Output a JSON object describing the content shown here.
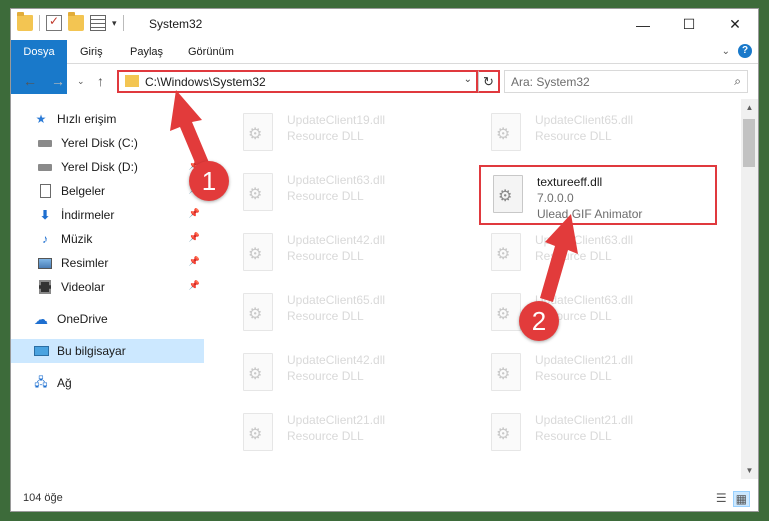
{
  "window": {
    "title": "System32"
  },
  "ribbon": {
    "tabs": [
      "Dosya",
      "Giriş",
      "Paylaş",
      "Görünüm"
    ]
  },
  "address": {
    "path": "C:\\Windows\\System32"
  },
  "search": {
    "placeholder": "Ara: System32"
  },
  "sidebar": {
    "items": [
      {
        "label": "Hızlı erişim",
        "icon": "star-icon",
        "pinned": false
      },
      {
        "label": "Yerel Disk (C:)",
        "icon": "drive-icon",
        "pinned": true
      },
      {
        "label": "Yerel Disk (D:)",
        "icon": "drive-icon",
        "pinned": true
      },
      {
        "label": "Belgeler",
        "icon": "documents-icon",
        "pinned": true
      },
      {
        "label": "İndirmeler",
        "icon": "download-icon",
        "pinned": true
      },
      {
        "label": "Müzik",
        "icon": "music-icon",
        "pinned": true
      },
      {
        "label": "Resimler",
        "icon": "pictures-icon",
        "pinned": true
      },
      {
        "label": "Videolar",
        "icon": "videos-icon",
        "pinned": true
      },
      {
        "label": "OneDrive",
        "icon": "cloud-icon",
        "pinned": false
      },
      {
        "label": "Bu bilgisayar",
        "icon": "computer-icon",
        "pinned": false
      },
      {
        "label": "Ağ",
        "icon": "network-icon",
        "pinned": false
      }
    ]
  },
  "files": {
    "left": [
      {
        "name": "UpdateClient19.dll",
        "desc": "Resource DLL"
      },
      {
        "name": "UpdateClient63.dll",
        "desc": "Resource DLL"
      },
      {
        "name": "UpdateClient42.dll",
        "desc": "Resource DLL"
      },
      {
        "name": "UpdateClient65.dll",
        "desc": "Resource DLL"
      },
      {
        "name": "UpdateClient42.dll",
        "desc": "Resource DLL"
      },
      {
        "name": "UpdateClient21.dll",
        "desc": "Resource DLL"
      }
    ],
    "right": [
      {
        "name": "UpdateClient65.dll",
        "desc": "Resource DLL"
      },
      {
        "name": "UpdateClient63.dll",
        "desc": "Resource DLL"
      },
      {
        "name": "UpdateClient63.dll",
        "desc": "Resource DLL"
      },
      {
        "name": "UpdateClient21.dll",
        "desc": "Resource DLL"
      },
      {
        "name": "UpdateClient21.dll",
        "desc": "Resource DLL"
      }
    ],
    "highlighted": {
      "name": "textureeff.dll",
      "version": "7.0.0.0",
      "desc": "Ulead GIF Animator"
    }
  },
  "status": {
    "count": "104 öğe"
  },
  "callouts": [
    "1",
    "2"
  ],
  "colors": {
    "accent": "#1979ca",
    "highlight": "#e0393e",
    "callout": "#e23b3b",
    "selected": "#cce8ff"
  }
}
